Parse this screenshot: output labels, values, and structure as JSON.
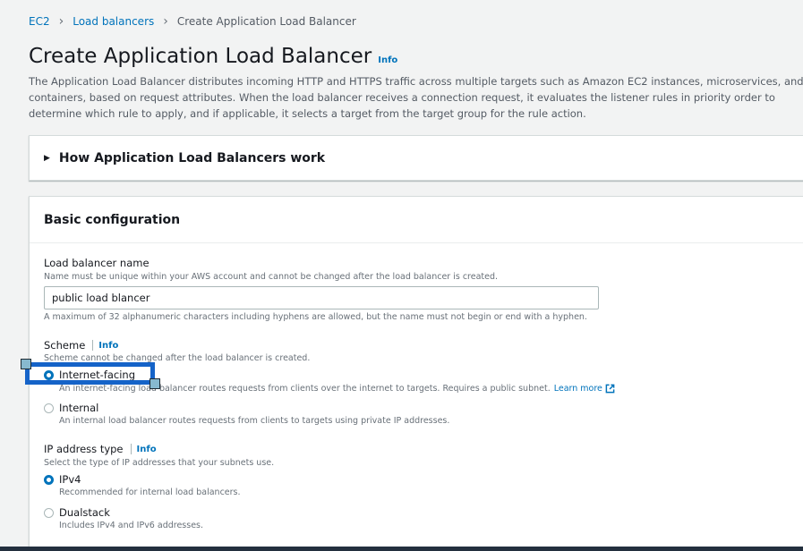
{
  "breadcrumb": {
    "items": [
      "EC2",
      "Load balancers"
    ],
    "current": "Create Application Load Balancer"
  },
  "header": {
    "title": "Create Application Load Balancer",
    "info": "Info",
    "description": "The Application Load Balancer distributes incoming HTTP and HTTPS traffic across multiple targets such as Amazon EC2 instances, microservices, and containers, based on request attributes. When the load balancer receives a connection request, it evaluates the listener rules in priority order to determine which rule to apply, and if applicable, it selects a target from the target group for the rule action."
  },
  "expander": {
    "label": "How Application Load Balancers work"
  },
  "basic": {
    "title": "Basic configuration",
    "name": {
      "label": "Load balancer name",
      "hint": "Name must be unique within your AWS account and cannot be changed after the load balancer is created.",
      "value": "public load blancer",
      "constraint": "A maximum of 32 alphanumeric characters including hyphens are allowed, but the name must not begin or end with a hyphen."
    },
    "scheme": {
      "label": "Scheme",
      "info": "Info",
      "hint": "Scheme cannot be changed after the load balancer is created.",
      "options": [
        {
          "label": "Internet-facing",
          "desc": "An internet-facing load balancer routes requests from clients over the internet to targets. Requires a public subnet.",
          "link": "Learn more",
          "checked": true
        },
        {
          "label": "Internal",
          "desc": "An internal load balancer routes requests from clients to targets using private IP addresses.",
          "checked": false
        }
      ]
    },
    "ip": {
      "label": "IP address type",
      "info": "Info",
      "hint": "Select the type of IP addresses that your subnets use.",
      "options": [
        {
          "label": "IPv4",
          "desc": "Recommended for internal load balancers.",
          "checked": true
        },
        {
          "label": "Dualstack",
          "desc": "Includes IPv4 and IPv6 addresses.",
          "checked": false
        }
      ]
    }
  },
  "colors": {
    "link": "#0073bb",
    "selection": "#1563c8",
    "background": "#f2f3f3"
  }
}
